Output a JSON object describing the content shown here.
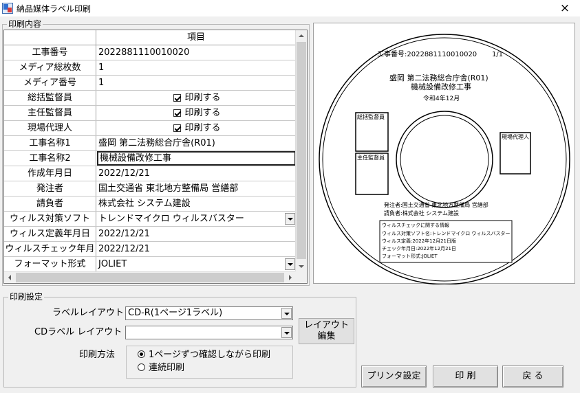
{
  "window": {
    "title": "納品媒体ラベル印刷",
    "close_label": "×"
  },
  "print_content": {
    "group_label": "印刷内容",
    "header": {
      "item": "項目"
    },
    "rows": [
      {
        "label": "工事番号",
        "value": "2022881110010020",
        "type": "text"
      },
      {
        "label": "メディア総枚数",
        "value": "1",
        "type": "text"
      },
      {
        "label": "メディア番号",
        "value": "1",
        "type": "text"
      },
      {
        "label": "総括監督員",
        "value": "印刷する",
        "type": "check",
        "checked": true
      },
      {
        "label": "主任監督員",
        "value": "印刷する",
        "type": "check",
        "checked": true
      },
      {
        "label": "現場代理人",
        "value": "印刷する",
        "type": "check",
        "checked": true
      },
      {
        "label": "工事名称1",
        "value": "盛岡 第二法務総合庁舎(R01)",
        "type": "text"
      },
      {
        "label": "工事名称2",
        "value": "機械設備改修工事",
        "type": "text",
        "selected": true
      },
      {
        "label": "作成年月日",
        "value": "2022/12/21",
        "type": "text"
      },
      {
        "label": "発注者",
        "value": "国土交通省 東北地方整備局 営繕部",
        "type": "text"
      },
      {
        "label": "請負者",
        "value": "株式会社 システム建設",
        "type": "text"
      },
      {
        "label": "ウィルス対策ソフト",
        "value": "トレンドマイクロ ウィルスバスター",
        "type": "dropdown"
      },
      {
        "label": "ウィルス定義年月日",
        "value": "2022/12/21",
        "type": "text"
      },
      {
        "label": "ウィルスチェック年月",
        "value": "2022/12/21",
        "type": "text"
      },
      {
        "label": "フォーマット形式",
        "value": "JOLIET",
        "type": "dropdown"
      }
    ]
  },
  "preview": {
    "koji_no": "工事番号:2022881110010020",
    "page": "1/1",
    "name1": "盛岡 第二法務総合庁舎(R01)",
    "name2": "機械設備改修工事",
    "date": "令和4年12月",
    "box_sokatsu": "総括監督員",
    "box_shunin": "主任監督員",
    "box_genba": "現場代理人",
    "orderer": "発注者:国土交通省 東北地方整備局 営繕部",
    "contractor": "請負者:株式会社 システム建設",
    "virus_title": "ウィルスチェックに関する情報",
    "virus_soft": "ウィルス対策ソフト名:トレンドマイクロ ウィルスバスター",
    "virus_def": "ウィルス定義:2022年12月21日版",
    "check_date": "チェック年月日:2022年12月21日",
    "format": "フォーマット形式:JOLIET"
  },
  "print_settings": {
    "group_label": "印刷設定",
    "label_layout": {
      "label": "ラベルレイアウト",
      "value": "CD-R(1ページ1ラベル)"
    },
    "cd_label_layout": {
      "label": "CDラベル レイアウト",
      "value": ""
    },
    "layout_edit_line1": "レイアウト",
    "layout_edit_line2": "編集",
    "method": {
      "label": "印刷方法",
      "options": [
        {
          "label": "1ページずつ確認しながら印刷",
          "selected": true
        },
        {
          "label": "連続印刷",
          "selected": false
        }
      ]
    }
  },
  "buttons": {
    "printer_setup": "プリンタ設定",
    "print": "印 刷",
    "back": "戻 る"
  }
}
